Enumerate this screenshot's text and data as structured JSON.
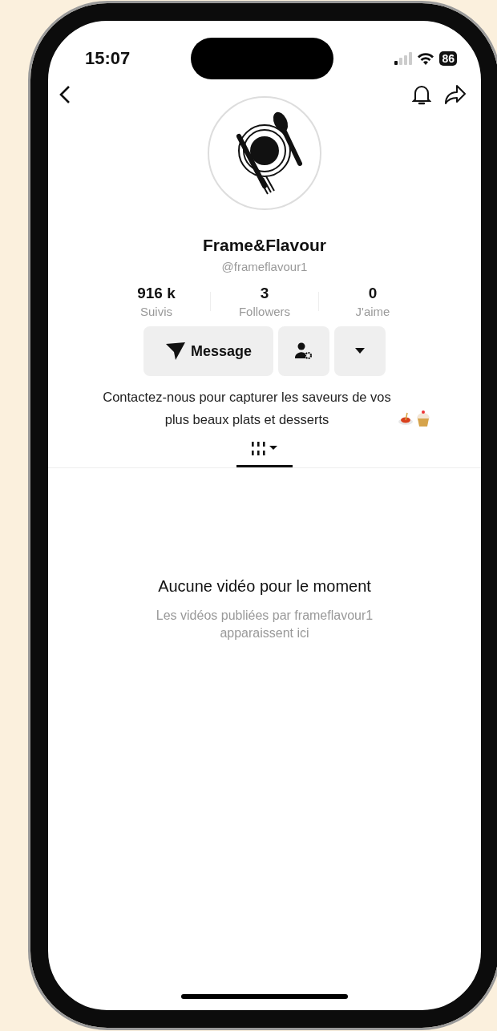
{
  "status_bar": {
    "time": "15:07",
    "battery": "86"
  },
  "profile": {
    "name": "Frame&Flavour",
    "handle": "@frameflavour1"
  },
  "stats": [
    {
      "value": "916 k",
      "label": "Suivis"
    },
    {
      "value": "3",
      "label": "Followers"
    },
    {
      "value": "0",
      "label": "J'aime"
    }
  ],
  "actions": {
    "message": "Message"
  },
  "bio": "Contactez-nous pour capturer les saveurs de vos plus beaux plats et desserts",
  "tabs": [
    {
      "selected": true
    }
  ],
  "empty_state": {
    "title": "Aucune vidéo pour le moment",
    "subtitle": "Les vidéos publiées par frameflavour1 apparaissent ici"
  }
}
